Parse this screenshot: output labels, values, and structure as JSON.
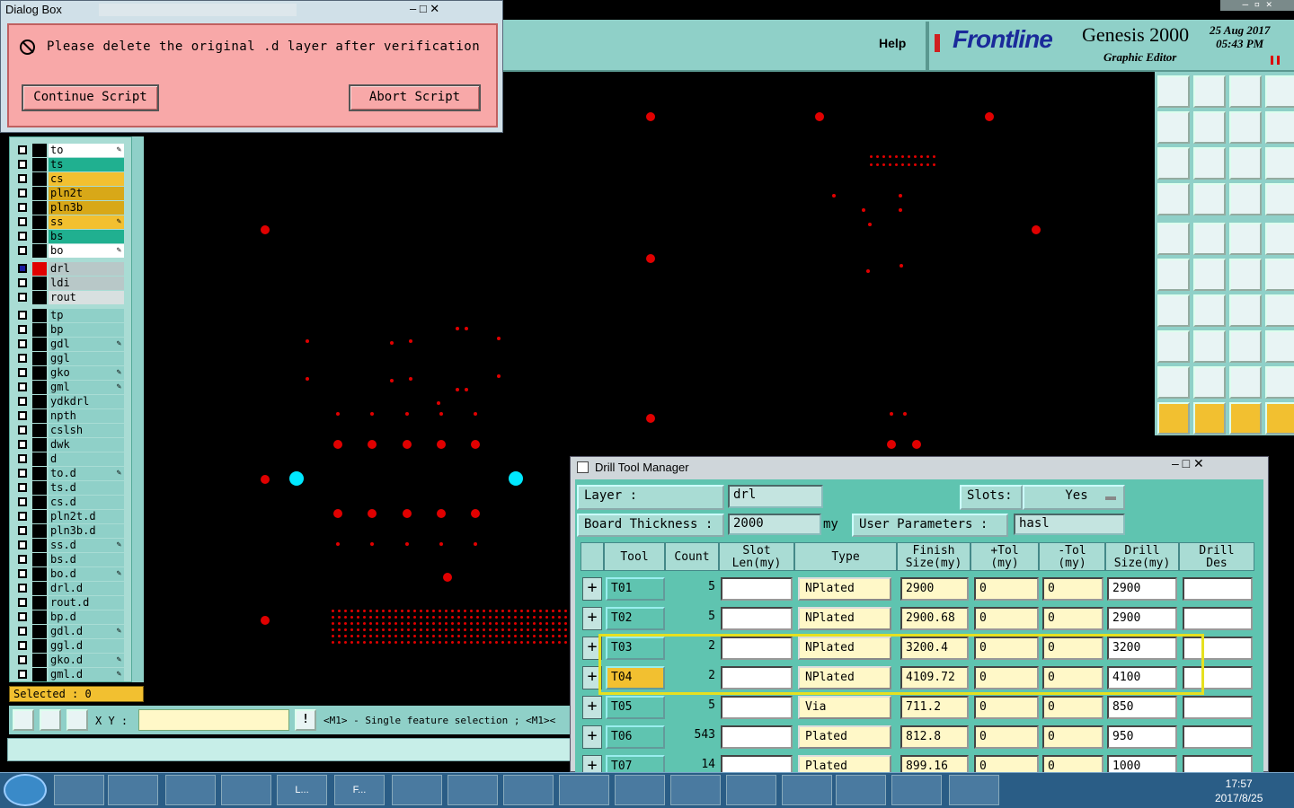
{
  "dialog": {
    "title": "Dialog Box",
    "controls": "–  □   ✕",
    "message": "Please delete the original .d layer after verification",
    "continue_label": "Continue Script",
    "abort_label": "Abort Script"
  },
  "header": {
    "help_label": "Help",
    "logo": "Frontline",
    "product": "Genesis 2000",
    "subtitle": "Graphic Editor",
    "date": "25 Aug 2017",
    "time": "05:43 PM"
  },
  "layers": {
    "items": [
      {
        "name": "to",
        "color": "#ffffff",
        "pen": true
      },
      {
        "name": "ts",
        "color": "#20b090",
        "pen": false
      },
      {
        "name": "cs",
        "color": "#f2c030",
        "pen": false
      },
      {
        "name": "pln2t",
        "color": "#d8a818",
        "pen": false
      },
      {
        "name": "pln3b",
        "color": "#d8a818",
        "pen": false
      },
      {
        "name": "ss",
        "color": "#f2c030",
        "pen": true
      },
      {
        "name": "bs",
        "color": "#20b090",
        "pen": false
      },
      {
        "name": "bo",
        "color": "#ffffff",
        "pen": true
      },
      {
        "name": "drl",
        "color": "#b8c8c8",
        "pen": false,
        "active": true
      },
      {
        "name": "ldi",
        "color": "#b8c8c8",
        "pen": false
      },
      {
        "name": "rout",
        "color": "#d8e0e0",
        "pen": false
      },
      {
        "name": "tp",
        "color": "#8fd0c8",
        "pen": false
      },
      {
        "name": "bp",
        "color": "#8fd0c8",
        "pen": false
      },
      {
        "name": "gdl",
        "color": "#8fd0c8",
        "pen": true
      },
      {
        "name": "ggl",
        "color": "#8fd0c8",
        "pen": false
      },
      {
        "name": "gko",
        "color": "#8fd0c8",
        "pen": true
      },
      {
        "name": "gml",
        "color": "#8fd0c8",
        "pen": true
      },
      {
        "name": "ydkdrl",
        "color": "#8fd0c8",
        "pen": false
      },
      {
        "name": "npth",
        "color": "#8fd0c8",
        "pen": false
      },
      {
        "name": "cslsh",
        "color": "#8fd0c8",
        "pen": false
      },
      {
        "name": "dwk",
        "color": "#8fd0c8",
        "pen": false
      },
      {
        "name": "d",
        "color": "#8fd0c8",
        "pen": false
      },
      {
        "name": "to.d",
        "color": "#8fd0c8",
        "pen": true
      },
      {
        "name": "ts.d",
        "color": "#8fd0c8",
        "pen": false
      },
      {
        "name": "cs.d",
        "color": "#8fd0c8",
        "pen": false
      },
      {
        "name": "pln2t.d",
        "color": "#8fd0c8",
        "pen": false
      },
      {
        "name": "pln3b.d",
        "color": "#8fd0c8",
        "pen": false
      },
      {
        "name": "ss.d",
        "color": "#8fd0c8",
        "pen": true
      },
      {
        "name": "bs.d",
        "color": "#8fd0c8",
        "pen": false
      },
      {
        "name": "bo.d",
        "color": "#8fd0c8",
        "pen": true
      },
      {
        "name": "drl.d",
        "color": "#8fd0c8",
        "pen": false
      },
      {
        "name": "rout.d",
        "color": "#8fd0c8",
        "pen": false
      },
      {
        "name": "bp.d",
        "color": "#8fd0c8",
        "pen": false
      },
      {
        "name": "gdl.d",
        "color": "#8fd0c8",
        "pen": true
      },
      {
        "name": "ggl.d",
        "color": "#8fd0c8",
        "pen": false
      },
      {
        "name": "gko.d",
        "color": "#8fd0c8",
        "pen": true
      },
      {
        "name": "gml.d",
        "color": "#8fd0c8",
        "pen": true
      }
    ],
    "selected_label": "Selected : 0"
  },
  "bottom": {
    "xy_label": "X Y :",
    "xy_value": "",
    "status": "<M1> - Single feature selection ; <M1><"
  },
  "drill_manager": {
    "title": "Drill Tool Manager",
    "controls": "–   □   ✕",
    "layer_label": "Layer          :",
    "layer_value": "drl",
    "slots_label": "Slots:",
    "slots_value": "Yes",
    "thickness_label": "Board Thickness :",
    "thickness_value": "2000",
    "thickness_unit": "my",
    "user_params_label": "User Parameters :",
    "user_params_value": "hasl",
    "columns": {
      "tool": "Tool",
      "count": "Count",
      "slot": "Slot\nLen(my)",
      "type": "Type",
      "finish": "Finish\nSize(my)",
      "ptol": "+Tol\n(my)",
      "ntol": "-Tol\n(my)",
      "drill": "Drill\nSize(my)",
      "des": "Drill\nDes"
    },
    "rows": [
      {
        "tool": "T01",
        "count": "5",
        "slot": "",
        "type": "NPlated",
        "finish": "2900",
        "ptol": "0",
        "ntol": "0",
        "drill": "2900",
        "des": ""
      },
      {
        "tool": "T02",
        "count": "5",
        "slot": "",
        "type": "NPlated",
        "finish": "2900.68",
        "ptol": "0",
        "ntol": "0",
        "drill": "2900",
        "des": ""
      },
      {
        "tool": "T03",
        "count": "2",
        "slot": "",
        "type": "NPlated",
        "finish": "3200.4",
        "ptol": "0",
        "ntol": "0",
        "drill": "3200",
        "des": ""
      },
      {
        "tool": "T04",
        "count": "2",
        "slot": "",
        "type": "NPlated",
        "finish": "4109.72",
        "ptol": "0",
        "ntol": "0",
        "drill": "4100",
        "des": "",
        "selected": true
      },
      {
        "tool": "T05",
        "count": "5",
        "slot": "",
        "type": "Via",
        "finish": "711.2",
        "ptol": "0",
        "ntol": "0",
        "drill": "850",
        "des": ""
      },
      {
        "tool": "T06",
        "count": "543",
        "slot": "",
        "type": "Plated",
        "finish": "812.8",
        "ptol": "0",
        "ntol": "0",
        "drill": "950",
        "des": ""
      },
      {
        "tool": "T07",
        "count": "14",
        "slot": "",
        "type": "Plated",
        "finish": "899.16",
        "ptol": "0",
        "ntol": "0",
        "drill": "1000",
        "des": ""
      }
    ]
  },
  "taskbar": {
    "time": "17:57",
    "date": "2017/8/25",
    "items": [
      "L...",
      "F..."
    ]
  },
  "colors": {
    "panel": "#8fd0c8",
    "dialog_body": "#f8a8a8",
    "highlight": "#e6e020",
    "pad": "#e00000",
    "pad_selected": "#00e8ff"
  }
}
